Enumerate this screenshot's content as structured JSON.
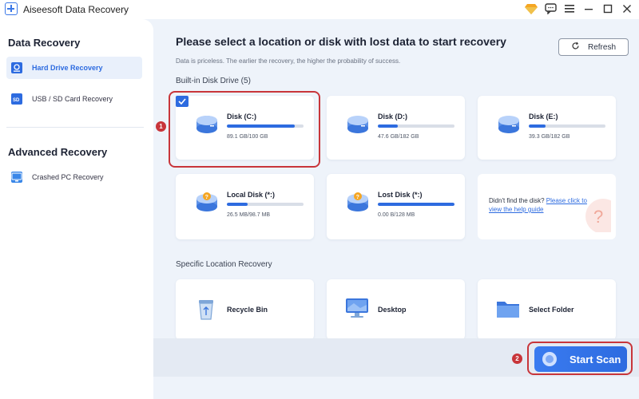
{
  "app": {
    "title": "Aiseesoft Data Recovery"
  },
  "sidebar": {
    "section1": "Data Recovery",
    "section2": "Advanced Recovery",
    "items": [
      {
        "label": "Hard Drive Recovery",
        "icon": "hard-drive-icon",
        "active": true
      },
      {
        "label": "USB / SD Card Recovery",
        "icon": "sd-card-icon",
        "active": false
      },
      {
        "label": "Crashed PC Recovery",
        "icon": "crashed-pc-icon",
        "active": false
      }
    ]
  },
  "main": {
    "title": "Please select a location or disk with lost data to start recovery",
    "subtitle": "Data is priceless. The earlier the recovery, the higher the probability of success.",
    "refresh_label": "Refresh",
    "builtin_label": "Built-in Disk Drive (5)",
    "disks": [
      {
        "name": "Disk (C:)",
        "size": "89.1 GB/100 GB",
        "fill": 0.89,
        "selected": true
      },
      {
        "name": "Disk (D:)",
        "size": "47.6 GB/182 GB",
        "fill": 0.26
      },
      {
        "name": "Disk (E:)",
        "size": "39.3 GB/182 GB",
        "fill": 0.22
      },
      {
        "name": "Local Disk (*:)",
        "size": "26.5 MB/98.7 MB",
        "fill": 0.27
      },
      {
        "name": "Lost Disk (*:)",
        "size": "0.00 B/128 MB",
        "fill": 1.0
      }
    ],
    "help": {
      "prefix": "Didn't find the disk? ",
      "link": "Please click to view the help guide"
    },
    "specific_label": "Specific Location Recovery",
    "locations": [
      {
        "name": "Recycle Bin",
        "icon": "recycle-bin-icon"
      },
      {
        "name": "Desktop",
        "icon": "desktop-icon"
      },
      {
        "name": "Select Folder",
        "icon": "folder-icon"
      }
    ],
    "start_scan_label": "Start Scan"
  },
  "annotations": {
    "step1": "1",
    "step2": "2"
  },
  "colors": {
    "accent": "#2d6be0",
    "highlight": "#c8353a"
  }
}
